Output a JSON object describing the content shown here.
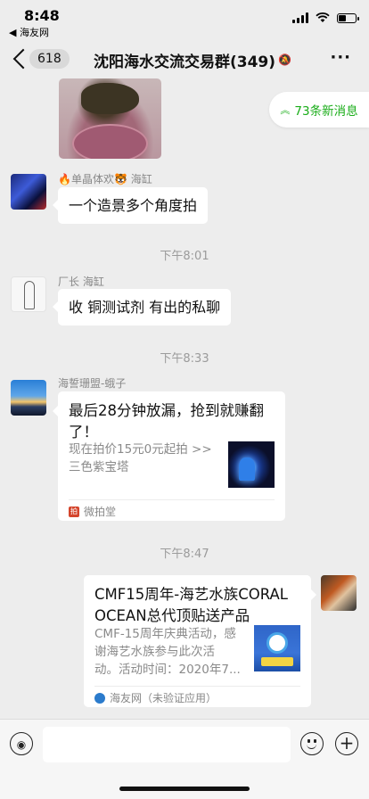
{
  "status_bar": {
    "time": "8:48",
    "back_app": "◀ 海友网"
  },
  "header": {
    "unread_count": "618",
    "title": "沈阳海水交流交易群(349)"
  },
  "new_messages": {
    "label": "73条新消息"
  },
  "messages": [
    {
      "sender": "🔥单晶体欢🐯 海缸",
      "text": "一个造景多个角度拍"
    },
    {
      "time": "下午8:01"
    },
    {
      "sender": "厂长 海缸",
      "text": "收 铜测试剂 有出的私聊"
    },
    {
      "time": "下午8:33"
    },
    {
      "sender": "海誓珊盟-蛾子",
      "card": {
        "title_line1": "最后28分钟放漏，抢到就赚翻",
        "title_line2": "了！",
        "desc_line1": "现在拍价15元0元起拍 >>",
        "desc_line2": "三色紫宝塔",
        "source": "微拍堂"
      }
    },
    {
      "time": "下午8:47"
    },
    {
      "card": {
        "title_line1": "CMF15周年-海艺水族CORAL",
        "title_line2": "OCEAN总代顶贴送产品",
        "desc_line1": "CMF-15周年庆典活动，感",
        "desc_line2": "谢海艺水族参与此次活",
        "desc_line3": "动。活动时间：2020年7...",
        "source": "海友网（未验证应用）"
      }
    }
  ],
  "input_bar": {
    "placeholder": ""
  },
  "colors": {
    "background": "#ededed",
    "accent_green": "#1aad19",
    "bubble": "#ffffff"
  },
  "icons": [
    "back-arrow-icon",
    "mute-icon",
    "more-icon",
    "voice-icon",
    "emoji-icon",
    "plus-icon",
    "chevron-up-icon"
  ]
}
